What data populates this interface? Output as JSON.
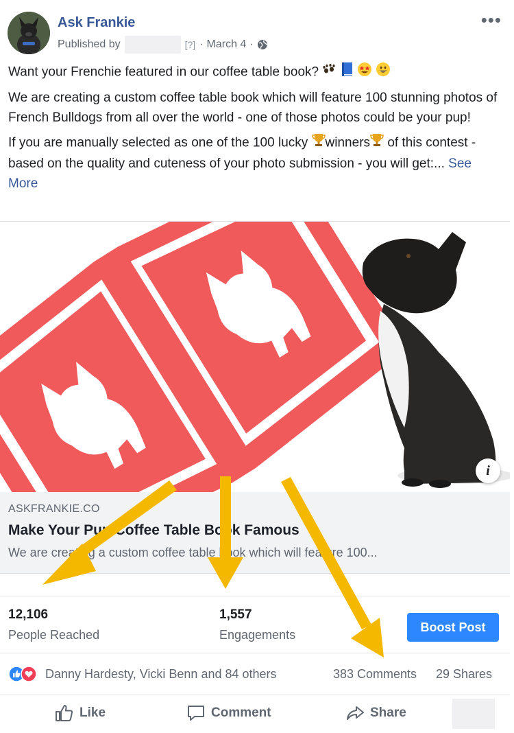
{
  "header": {
    "page_name": "Ask Frankie",
    "published_by": "Published by",
    "help_marker": "[?]",
    "separator": "·",
    "date": "March 4",
    "more_icon": "ellipsis-icon"
  },
  "post": {
    "line1": "Want your Frenchie featured in our coffee table book?",
    "para2": "We are creating a custom coffee table book which will feature 100 stunning photos of French Bulldogs from all over the world - one of those photos could be your pup!",
    "para3_a": "If you are manually selected as one of the 100 lucky",
    "para3_b": "winners",
    "para3_c": "of this contest - based on the quality and cuteness of your photo submission - you will get:...",
    "see_more": "See More"
  },
  "link_preview": {
    "domain": "ASKFRANKIE.CO",
    "title": "Make Your Pup Coffee Table Book Famous",
    "description": "We are creating a custom coffee table book which will feature 100..."
  },
  "stats": {
    "reach_value": "12,106",
    "reach_label": "People Reached",
    "engagements_value": "1,557",
    "engagements_label": "Engagements",
    "boost_label": "Boost Post"
  },
  "reactions": {
    "names": "Danny Hardesty, Vicki Benn and 84 others",
    "comments": "383 Comments",
    "shares": "29 Shares"
  },
  "actions": {
    "like": "Like",
    "comment": "Comment",
    "share": "Share"
  },
  "colors": {
    "facebook_link": "#385898",
    "boost_blue": "#2d88ff",
    "brand_red": "#f05a5b",
    "arrow_yellow": "#f5b800"
  }
}
